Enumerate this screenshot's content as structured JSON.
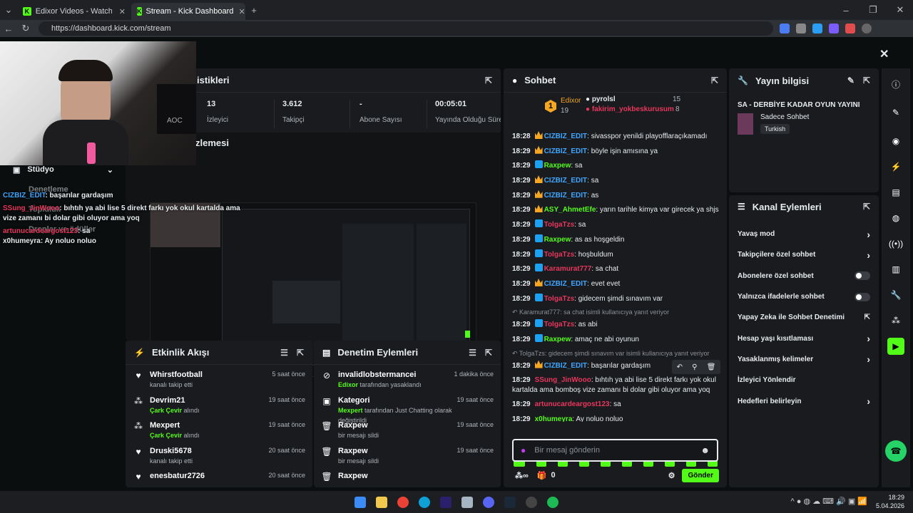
{
  "browser": {
    "tabs": [
      {
        "label": "Edixor Videos - Watch On-Deman"
      },
      {
        "label": "Stream - Kick Dashboard"
      }
    ],
    "url": "https://dashboard.kick.com/stream",
    "colors": {
      "accent": "#53fc18"
    }
  },
  "stats": {
    "title_partial": "istikleri",
    "items": [
      {
        "value": "13",
        "label": "İzleyici"
      },
      {
        "value": "3.612",
        "label": "Takipçi"
      },
      {
        "value": "-",
        "label": "Abone Sayısı"
      },
      {
        "value": "00:05:01",
        "label": "Yayında Olduğu Süre"
      }
    ]
  },
  "preview": {
    "title_partial": "zlemesi"
  },
  "studio": {
    "label": "Stüdyo",
    "items": [
      "Denetleme",
      "Topluluk",
      "Droplar ve ödüller"
    ]
  },
  "overlay_chat": [
    {
      "user": "CIZBIZ_EDIT",
      "text": ": başarılar gardaşım"
    },
    {
      "user": "SSung_JinWooo",
      "text": ": bıhtıh ya abi lise 5 direkt farkı yok okul kartalda ama vize zamanı bi dolar gibi oluyor ama yoq"
    },
    {
      "user": "artunucardeargost123",
      "text": ": sa"
    },
    {
      "user": "x0humeyra",
      "text": ": Ay noluo noluo"
    }
  ],
  "events": {
    "title": "Etkinlik Akışı",
    "rows": [
      {
        "icon": "heart-icon",
        "glyph": "♥",
        "user": "Whirstfootball",
        "desc": "kanalı takip etti",
        "hl": "",
        "time": "5 saat önce"
      },
      {
        "icon": "wheel-icon",
        "glyph": "⁂",
        "user": "Devrim21",
        "desc": " alındı",
        "hl": "Çark Çevir",
        "time": "19 saat önce"
      },
      {
        "icon": "wheel-icon",
        "glyph": "⁂",
        "user": "Mexpert",
        "desc": " alındı",
        "hl": "Çark Çevir",
        "time": "19 saat önce"
      },
      {
        "icon": "heart-icon",
        "glyph": "♥",
        "user": "Druski5678",
        "desc": "kanalı takip etti",
        "hl": "",
        "time": "20 saat önce"
      },
      {
        "icon": "heart-icon",
        "glyph": "♥",
        "user": "enesbatur2726",
        "desc": "",
        "hl": "",
        "time": "20 saat önce"
      }
    ]
  },
  "moderation": {
    "title": "Denetim Eylemleri",
    "rows": [
      {
        "icon": "ban-icon",
        "glyph": "⊘",
        "user": "invalidlobstermancei",
        "pre": "Edixor",
        "desc": " tarafından yasaklandı",
        "time": "1 dakika önce"
      },
      {
        "icon": "category-icon",
        "glyph": "▣",
        "user": "Kategori",
        "pre": "Mexpert",
        "desc": " tarafından Just Chatting olarak değiştirildi",
        "time": "19 saat önce"
      },
      {
        "icon": "trash-icon",
        "glyph": "🗑",
        "user": "Raxpew",
        "pre": "",
        "desc": "bir mesajı sildi",
        "time": "19 saat önce"
      },
      {
        "icon": "trash-icon",
        "glyph": "🗑",
        "user": "Raxpew",
        "pre": "",
        "desc": "bir mesajı sildi",
        "time": "19 saat önce"
      },
      {
        "icon": "trash-icon",
        "glyph": "🗑",
        "user": "Raxpew",
        "pre": "",
        "desc": "",
        "time": ""
      }
    ]
  },
  "chat": {
    "title": "Sohbet",
    "leaderboard": {
      "rank": "1",
      "top_user": "Edixor",
      "top_value": "19",
      "entries": [
        {
          "user": "pyrolsl",
          "value": "15"
        },
        {
          "user": "fakirim_yokbeskurusum",
          "value": "8"
        }
      ]
    },
    "messages": [
      {
        "time": "18:28",
        "user": "CIZBIZ_EDIT",
        "color": "#3ea6ff",
        "badge": "crown",
        "text": ": sivasspor yenildi playofflaraçıkamadı"
      },
      {
        "time": "18:29",
        "user": "CIZBIZ_EDIT",
        "color": "#3ea6ff",
        "badge": "crown",
        "text": ": böyle işin amısına ya"
      },
      {
        "time": "18:29",
        "user": "Raxpew",
        "color": "#53fc18",
        "badge": "blue",
        "text": ": sa"
      },
      {
        "time": "18:29",
        "user": "CIZBIZ_EDIT",
        "color": "#3ea6ff",
        "badge": "crown",
        "text": ": sa"
      },
      {
        "time": "18:29",
        "user": "CIZBIZ_EDIT",
        "color": "#3ea6ff",
        "badge": "crown",
        "text": ": as"
      },
      {
        "time": "18:29",
        "user": "ASY_AhmetEfe",
        "color": "#53fc18",
        "badge": "crown",
        "text": ": yarın tarihle kimya var girecek ya shjs"
      },
      {
        "time": "18:29",
        "user": "TolgaTzs",
        "color": "#e8365d",
        "badge": "blue",
        "text": ": sa"
      },
      {
        "time": "18:29",
        "user": "Raxpew",
        "color": "#53fc18",
        "badge": "blue",
        "text": ": as as hoşgeldin"
      },
      {
        "time": "18:29",
        "user": "TolgaTzs",
        "color": "#e8365d",
        "badge": "blue",
        "text": ": hoşbuldum"
      },
      {
        "time": "18:29",
        "user": "Karamurat777",
        "color": "#e8365d",
        "badge": "blue",
        "text": ": sa chat"
      },
      {
        "time": "18:29",
        "user": "CIZBIZ_EDIT",
        "color": "#3ea6ff",
        "badge": "crown",
        "text": ": evet evet"
      },
      {
        "time": "18:29",
        "user": "TolgaTzs",
        "color": "#e8365d",
        "badge": "blue",
        "text": ": gidecem şimdi sınavım var"
      },
      {
        "reply": "Karamurat777: sa chat isimli kullanıcıya yanıt veriyor"
      },
      {
        "time": "18:29",
        "user": "TolgaTzs",
        "color": "#e8365d",
        "badge": "blue",
        "text": ": as abi"
      },
      {
        "time": "18:29",
        "user": "Raxpew",
        "color": "#53fc18",
        "badge": "blue",
        "text": ": amaç ne abi oyunun"
      },
      {
        "reply": "TolgaTzs: gidecem şimdi sınavım var isimli kullanıcıya yanıt veriyor"
      },
      {
        "time": "18:29",
        "user": "CIZBIZ_EDIT",
        "color": "#3ea6ff",
        "badge": "crown",
        "text": ": başarılar gardaşım"
      },
      {
        "time": "18:29",
        "user": "SSung_JinWooo",
        "color": "#e8365d",
        "badge": "none",
        "text": ": bıhtıh ya abi lise 5 direkt farkı yok okul",
        "cont": "kartalda ama bomboş vize zamanı bi dolar gibi oluyor ama yoq"
      },
      {
        "time": "18:29",
        "user": "artunucardeargost123",
        "color": "#e8365d",
        "badge": "none",
        "text": ": sa"
      },
      {
        "time": "18:29",
        "user": "x0humeyra",
        "color": "#53fc18",
        "badge": "none",
        "text": ": Ay noluo noluo"
      }
    ],
    "input_placeholder": "Bir mesaj gönderin",
    "points": "0",
    "send_label": "Gönder"
  },
  "stream_info": {
    "title": "Yayın bilgisi",
    "stream_title": "SA - DERBİYE KADAR OYUN YAYINI",
    "category": "Sadece Sohbet",
    "tag": "Turkish"
  },
  "channel_actions": {
    "title": "Kanal Eylemleri",
    "items": [
      {
        "label": "Yavaş mod",
        "type": "arrow"
      },
      {
        "label": "Takipçilere özel sohbet",
        "type": "arrow"
      },
      {
        "label": "Abonelere özel sohbet",
        "type": "toggle"
      },
      {
        "label": "Yalnızca ifadelerle sohbet",
        "type": "toggle"
      },
      {
        "label": "Yapay Zeka ile Sohbet Denetimi",
        "type": "ext"
      },
      {
        "label": "Hesap yaşı kısıtlaması",
        "type": "arrow"
      },
      {
        "label": "Yasaklanmış kelimeler",
        "type": "arrow"
      },
      {
        "label": "İzleyici Yönlendir",
        "type": "none"
      },
      {
        "label": "Hedefleri belirleyin",
        "type": "arrow"
      }
    ]
  },
  "taskbar": {
    "time": "18:29",
    "date": "5.04.2026"
  }
}
